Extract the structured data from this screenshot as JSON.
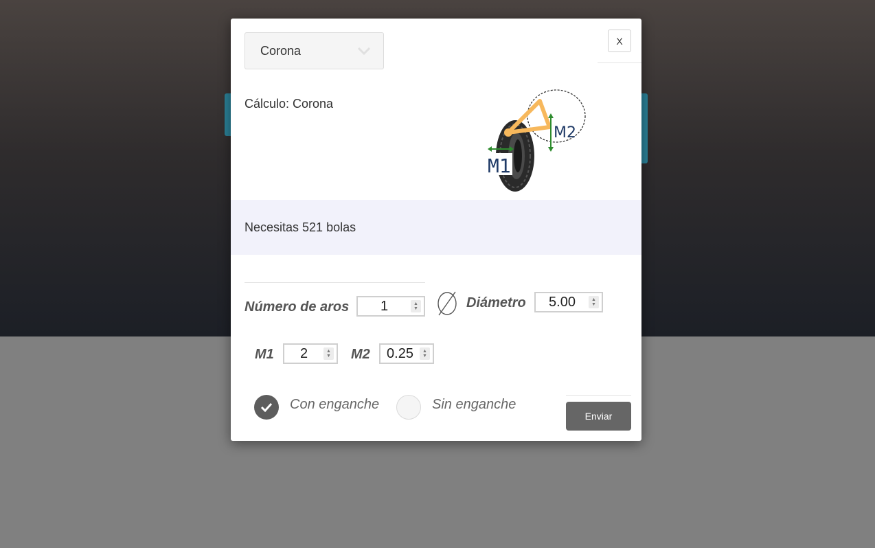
{
  "select": {
    "value": "Corona",
    "icon": "chevron-down-icon"
  },
  "close": {
    "label": "X"
  },
  "calc_title": "Cálculo: Corona",
  "illustration": {
    "m1_label": "M1",
    "m2_label": "M2"
  },
  "result": {
    "text": "Necesitas 521 bolas"
  },
  "fields": {
    "rings_label": "Número de aros",
    "rings_value": "1",
    "diameter_label": "Diámetro",
    "diameter_value": "5.00",
    "m1_label": "M1",
    "m1_value": "2",
    "m2_label": "M2",
    "m2_value": "0.25"
  },
  "options": {
    "with_hook": "Con enganche",
    "without_hook": "Sin enganche",
    "selected": "with_hook"
  },
  "submit_label": "Enviar",
  "colors": {
    "radio_selected": "#5d5d5d",
    "button": "#666666",
    "result_bg": "#f2f2fb",
    "illustration_accent": "#f7b85c",
    "illustration_arrow": "#2e8b2e",
    "illustration_label": "#1f3a66"
  }
}
